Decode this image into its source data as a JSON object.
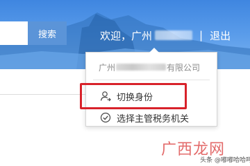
{
  "header": {
    "search_button": "搜索",
    "welcome_prefix": "欢迎，广州",
    "separator": "|",
    "logout": "退出"
  },
  "dropdown": {
    "company_prefix": "广州",
    "company_suffix": "有限公司",
    "items": [
      {
        "label": "切换身份",
        "icon": "user-switch-icon"
      },
      {
        "label": "选择主管税务机关",
        "icon": "check-circle-icon"
      }
    ]
  },
  "watermark": {
    "logo_text": "广西龙网",
    "source_text": "头条 @嘟嘟哈哈呵呵"
  },
  "colors": {
    "header_blue": "#3f86e0",
    "highlight_red": "#d8222a",
    "watermark_red": "#e36b6b"
  }
}
